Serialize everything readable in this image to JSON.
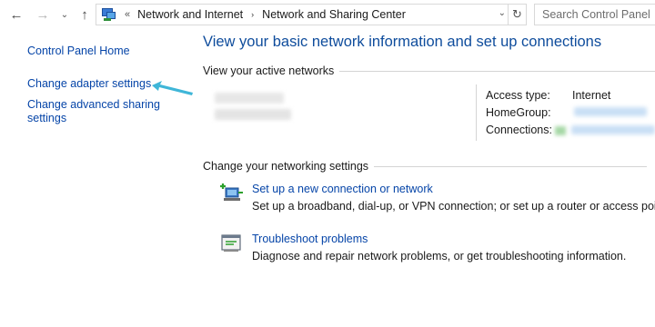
{
  "address": {
    "back_glyph": "←",
    "forward_glyph": "→",
    "recent_glyph": "⌄",
    "up_glyph": "↑",
    "overflow_glyph": "«",
    "breadcrumbs": [
      "Network and Internet",
      "Network and Sharing Center"
    ],
    "separator_glyph": "›",
    "dropdown_glyph": "⌄",
    "refresh_glyph": "↻",
    "location_icon": "network-sharing-icon"
  },
  "search": {
    "placeholder": "Search Control Panel"
  },
  "sidebar": {
    "items": [
      {
        "label": "Control Panel Home"
      },
      {
        "label": "Change adapter settings"
      },
      {
        "label": "Change advanced sharing settings"
      }
    ],
    "pointer_color": "#3fb6d8"
  },
  "main": {
    "title": "View your basic network information and set up connections",
    "active_networks_header": "View your active networks",
    "network_details": {
      "access_type_label": "Access type:",
      "access_type_value": "Internet",
      "homegroup_label": "HomeGroup:",
      "connections_label": "Connections:"
    },
    "change_settings_header": "Change your networking settings",
    "tasks": [
      {
        "icon": "new-connection-icon",
        "link": "Set up a new connection or network",
        "description": "Set up a broadband, dial-up, or VPN connection; or set up a router or access point."
      },
      {
        "icon": "troubleshoot-icon",
        "link": "Troubleshoot problems",
        "description": "Diagnose and repair network problems, or get troubleshooting information."
      }
    ]
  },
  "colors": {
    "link": "#0645a8",
    "title": "#0e4c9c",
    "rule": "#d4d4d4"
  }
}
